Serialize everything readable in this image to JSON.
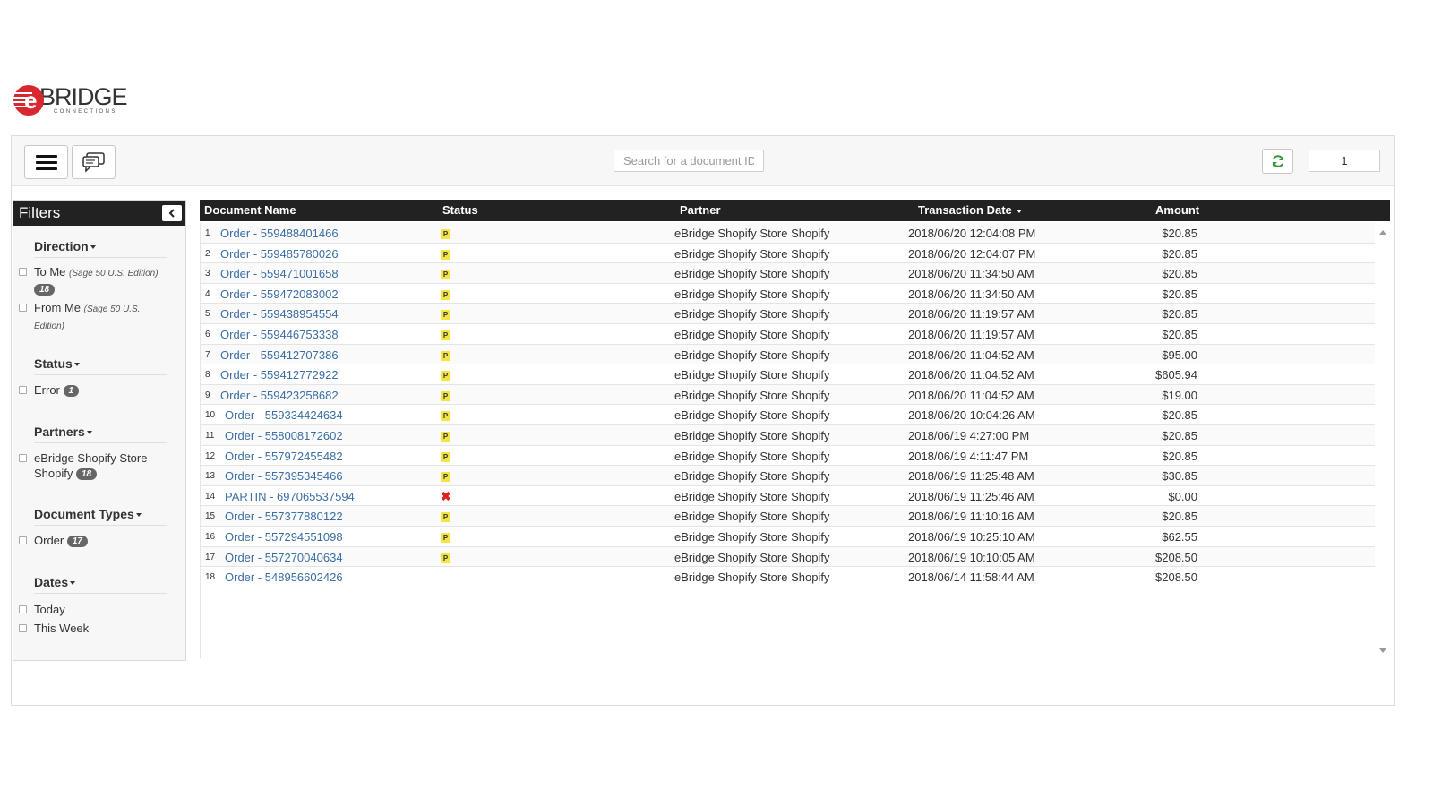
{
  "logo": {
    "brand": "BRIDGE",
    "sub": "CONNECTIONS",
    "accent_color": "#d7282f"
  },
  "toolbar": {
    "menu_icon": "hamburger-icon",
    "chat_icon": "chat-icon",
    "search_placeholder": "Search for a document ID.",
    "refresh_icon": "refresh-icon",
    "page_number": "1"
  },
  "filters": {
    "title": "Filters",
    "groups": {
      "direction": {
        "title": "Direction",
        "items": [
          {
            "label": "To Me",
            "note": "(Sage 50 U.S. Edition)",
            "count": "18"
          },
          {
            "label": "From Me",
            "note": "(Sage 50 U.S. Edition)"
          }
        ]
      },
      "status": {
        "title": "Status",
        "items": [
          {
            "label": "Error",
            "count": "1"
          }
        ]
      },
      "partners": {
        "title": "Partners",
        "items": [
          {
            "label": "eBridge Shopify Store Shopify",
            "count": "18"
          }
        ]
      },
      "document_types": {
        "title": "Document Types",
        "items": [
          {
            "label": "Order",
            "count": "17"
          }
        ]
      },
      "dates": {
        "title": "Dates",
        "items": [
          {
            "label": "Today"
          },
          {
            "label": "This Week"
          }
        ]
      }
    }
  },
  "table": {
    "headers": {
      "document_name": "Document Name",
      "status": "Status",
      "partner": "Partner",
      "transaction_date": "Transaction Date",
      "amount": "Amount"
    },
    "rows": [
      {
        "num": "1",
        "doc": "Order - 559488401466",
        "status": "P",
        "partner": "eBridge Shopify Store Shopify",
        "date": "2018/06/20 12:04:08 PM",
        "amount": "$20.85"
      },
      {
        "num": "2",
        "doc": "Order - 559485780026",
        "status": "P",
        "partner": "eBridge Shopify Store Shopify",
        "date": "2018/06/20 12:04:07 PM",
        "amount": "$20.85"
      },
      {
        "num": "3",
        "doc": "Order - 559471001658",
        "status": "P",
        "partner": "eBridge Shopify Store Shopify",
        "date": "2018/06/20 11:34:50 AM",
        "amount": "$20.85"
      },
      {
        "num": "4",
        "doc": "Order - 559472083002",
        "status": "P",
        "partner": "eBridge Shopify Store Shopify",
        "date": "2018/06/20 11:34:50 AM",
        "amount": "$20.85"
      },
      {
        "num": "5",
        "doc": "Order - 559438954554",
        "status": "P",
        "partner": "eBridge Shopify Store Shopify",
        "date": "2018/06/20 11:19:57 AM",
        "amount": "$20.85"
      },
      {
        "num": "6",
        "doc": "Order - 559446753338",
        "status": "P",
        "partner": "eBridge Shopify Store Shopify",
        "date": "2018/06/20 11:19:57 AM",
        "amount": "$20.85"
      },
      {
        "num": "7",
        "doc": "Order - 559412707386",
        "status": "P",
        "partner": "eBridge Shopify Store Shopify",
        "date": "2018/06/20 11:04:52 AM",
        "amount": "$95.00"
      },
      {
        "num": "8",
        "doc": "Order - 559412772922",
        "status": "P",
        "partner": "eBridge Shopify Store Shopify",
        "date": "2018/06/20 11:04:52 AM",
        "amount": "$605.94"
      },
      {
        "num": "9",
        "doc": "Order - 559423258682",
        "status": "P",
        "partner": "eBridge Shopify Store Shopify",
        "date": "2018/06/20 11:04:52 AM",
        "amount": "$19.00"
      },
      {
        "num": "10",
        "doc": "Order - 559334424634",
        "status": "P",
        "partner": "eBridge Shopify Store Shopify",
        "date": "2018/06/20 10:04:26 AM",
        "amount": "$20.85"
      },
      {
        "num": "11",
        "doc": "Order - 558008172602",
        "status": "P",
        "partner": "eBridge Shopify Store Shopify",
        "date": "2018/06/19 4:27:00 PM",
        "amount": "$20.85"
      },
      {
        "num": "12",
        "doc": "Order - 557972455482",
        "status": "P",
        "partner": "eBridge Shopify Store Shopify",
        "date": "2018/06/19 4:11:47 PM",
        "amount": "$20.85"
      },
      {
        "num": "13",
        "doc": "Order - 557395345466",
        "status": "P",
        "partner": "eBridge Shopify Store Shopify",
        "date": "2018/06/19 11:25:48 AM",
        "amount": "$30.85"
      },
      {
        "num": "14",
        "doc": "PARTIN - 697065537594",
        "status": "error",
        "partner": "eBridge Shopify Store Shopify",
        "date": "2018/06/19 11:25:46 AM",
        "amount": "$0.00"
      },
      {
        "num": "15",
        "doc": "Order - 557377880122",
        "status": "P",
        "partner": "eBridge Shopify Store Shopify",
        "date": "2018/06/19 11:10:16 AM",
        "amount": "$20.85"
      },
      {
        "num": "16",
        "doc": "Order - 557294551098",
        "status": "P",
        "partner": "eBridge Shopify Store Shopify",
        "date": "2018/06/19 10:25:10 AM",
        "amount": "$62.55"
      },
      {
        "num": "17",
        "doc": "Order - 557270040634",
        "status": "P",
        "partner": "eBridge Shopify Store Shopify",
        "date": "2018/06/19 10:10:05 AM",
        "amount": "$208.50"
      },
      {
        "num": "18",
        "doc": "Order - 548956602426",
        "status": "",
        "partner": "eBridge Shopify Store Shopify",
        "date": "2018/06/14 11:58:44 AM",
        "amount": "$208.50"
      }
    ]
  }
}
